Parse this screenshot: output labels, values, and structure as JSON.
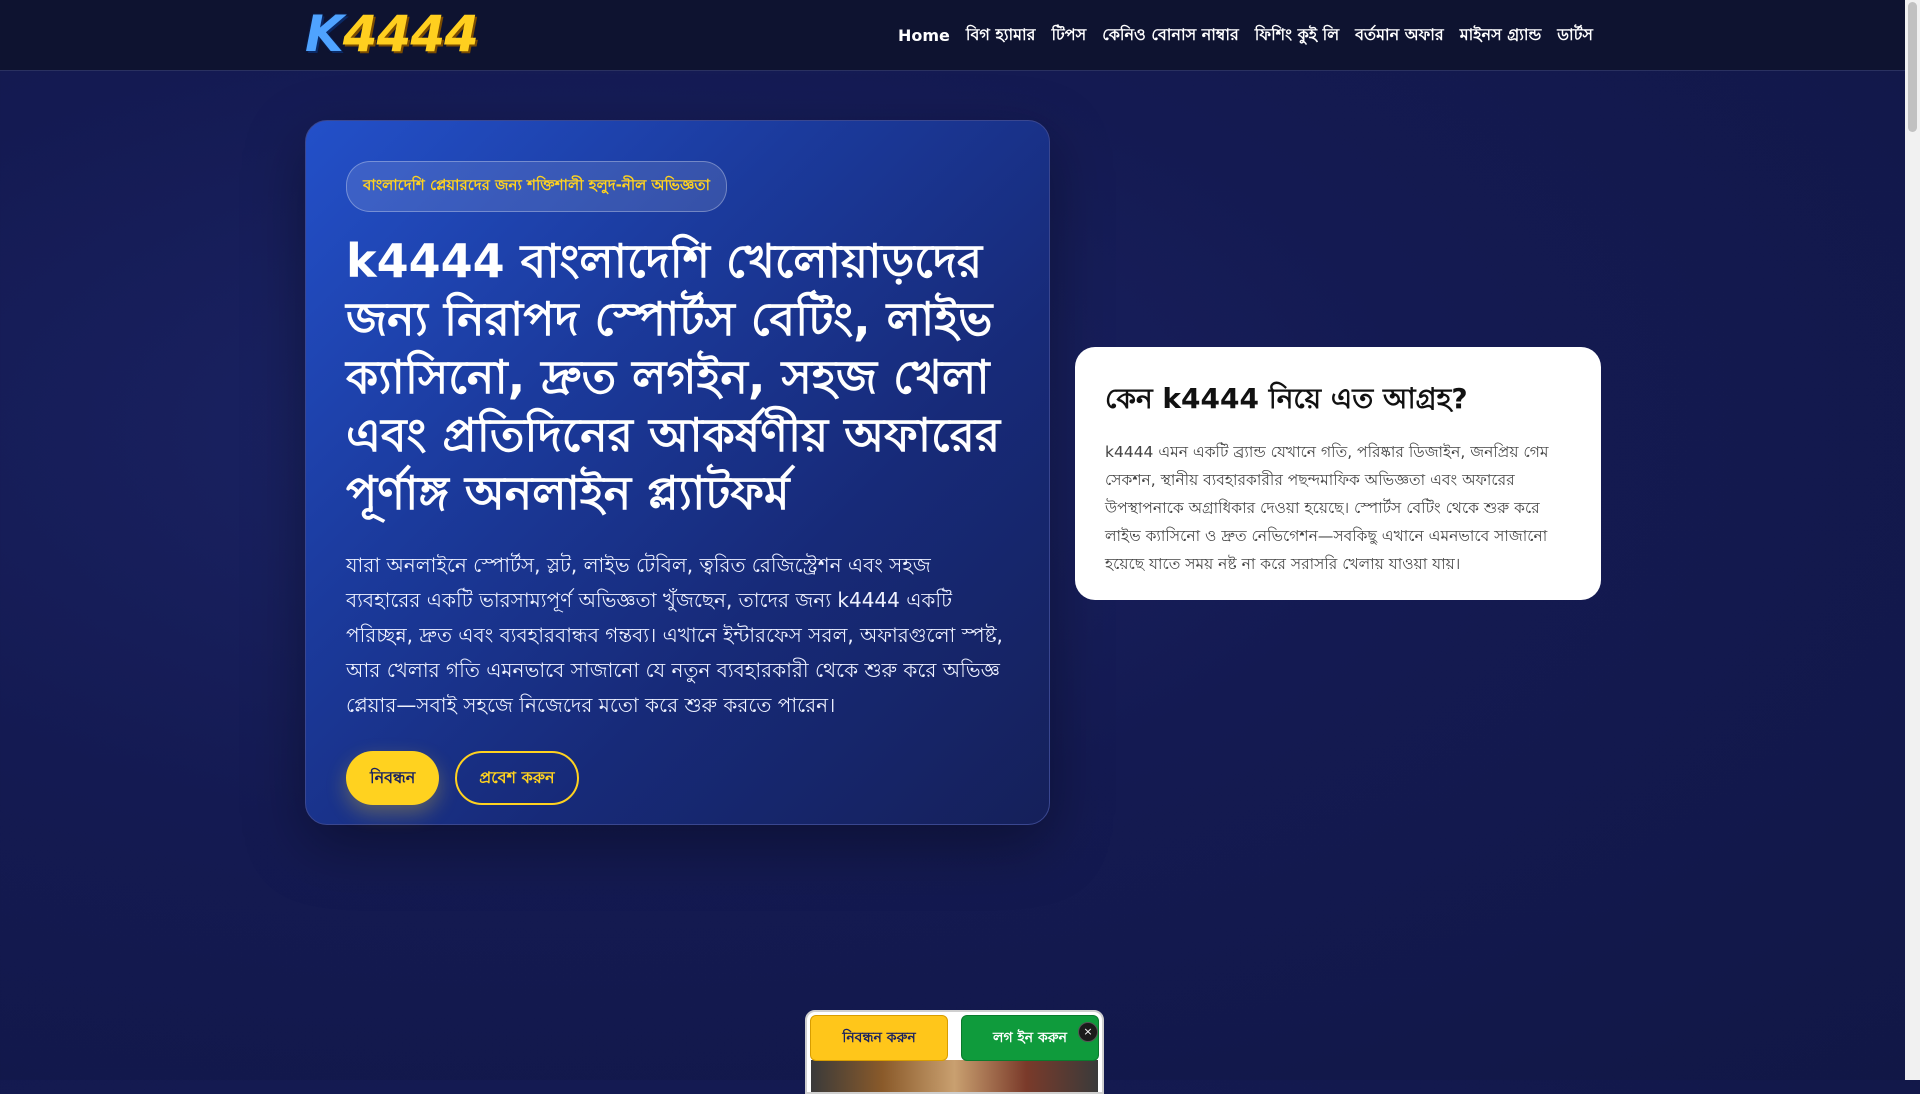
{
  "header": {
    "logo": {
      "k": "K",
      "num": "4444"
    },
    "nav": [
      "Home",
      "বিগ হ্যামার",
      "টিপস",
      "কেনিও বোনাস নাম্বার",
      "ফিশিং কুই লি",
      "বর্তমান অফার",
      "মাইনস গ্র্যান্ড",
      "ডার্টস"
    ]
  },
  "hero": {
    "pill": "বাংলাদেশি প্লেয়ারদের জন্য শক্তিশালী হলুদ-নীল অভিজ্ঞতা",
    "title": "k4444 বাংলাদেশি খেলোয়াড়দের জন্য নিরাপদ স্পোর্টস বেটিং, লাইভ ক্যাসিনো, দ্রুত লগইন, সহজ খেলা এবং প্রতিদিনের আকর্ষণীয় অফারের পূর্ণাঙ্গ অনলাইন প্ল্যাটফর্ম",
    "description": "যারা অনলাইনে স্পোর্টস, স্লট, লাইভ টেবিল, ত্বরিত রেজিস্ট্রেশন এবং সহজ ব্যবহারের একটি ভারসাম্যপূর্ণ অভিজ্ঞতা খুঁজছেন, তাদের জন্য k4444 একটি পরিচ্ছন্ন, দ্রুত এবং ব্যবহারবান্ধব গন্তব্য। এখানে ইন্টারফেস সরল, অফারগুলো স্পষ্ট, আর খেলার গতি এমনভাবে সাজানো যে নতুন ব্যবহারকারী থেকে শুরু করে অভিজ্ঞ প্লেয়ার—সবাই সহজে নিজেদের মতো করে শুরু করতে পারেন।",
    "register_label": "নিবন্ধন",
    "login_label": "প্রবেশ করুন"
  },
  "card": {
    "title": "কেন k4444 নিয়ে এত আগ্রহ?",
    "body": "k4444 এমন একটি ব্র্যান্ড যেখানে গতি, পরিষ্কার ডিজাইন, জনপ্রিয় গেম সেকশন, স্থানীয় ব্যবহারকারীর পছন্দমাফিক অভিজ্ঞতা এবং অফারের উপস্থাপনাকে অগ্রাধিকার দেওয়া হয়েছে। স্পোর্টস বেটিং থেকে শুরু করে লাইভ ক্যাসিনো ও দ্রুত নেভিগেশন—সবকিছু এখানে এমনভাবে সাজানো হয়েছে যাতে সময় নষ্ট না করে সরাসরি খেলায় যাওয়া যায়।"
  },
  "floating_bar": {
    "register_label": "নিবন্ধন করুন",
    "login_label": "লগ ইন করুন",
    "close_label": "×"
  }
}
